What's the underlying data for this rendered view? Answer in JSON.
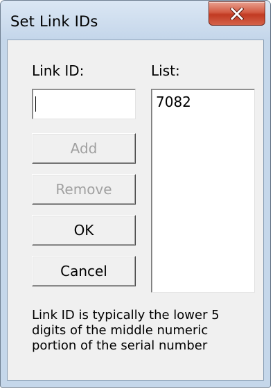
{
  "window": {
    "title": "Set Link IDs"
  },
  "titlebar": {
    "close_icon": "close-icon"
  },
  "link_id": {
    "label": "Link ID:",
    "value": ""
  },
  "list": {
    "label": "List:",
    "items": [
      "7082"
    ]
  },
  "buttons": {
    "add_label": "Add",
    "remove_label": "Remove",
    "ok_label": "OK",
    "cancel_label": "Cancel"
  },
  "hint": {
    "lines": [
      "Link ID is typically the lower 5",
      "digits of the middle numeric",
      "portion of the serial number"
    ]
  },
  "colors": {
    "titlebar": "#c5d7ea",
    "close_button": "#c7442b",
    "client": "#f0f0f0",
    "disabled_text": "#a0a0a0"
  }
}
